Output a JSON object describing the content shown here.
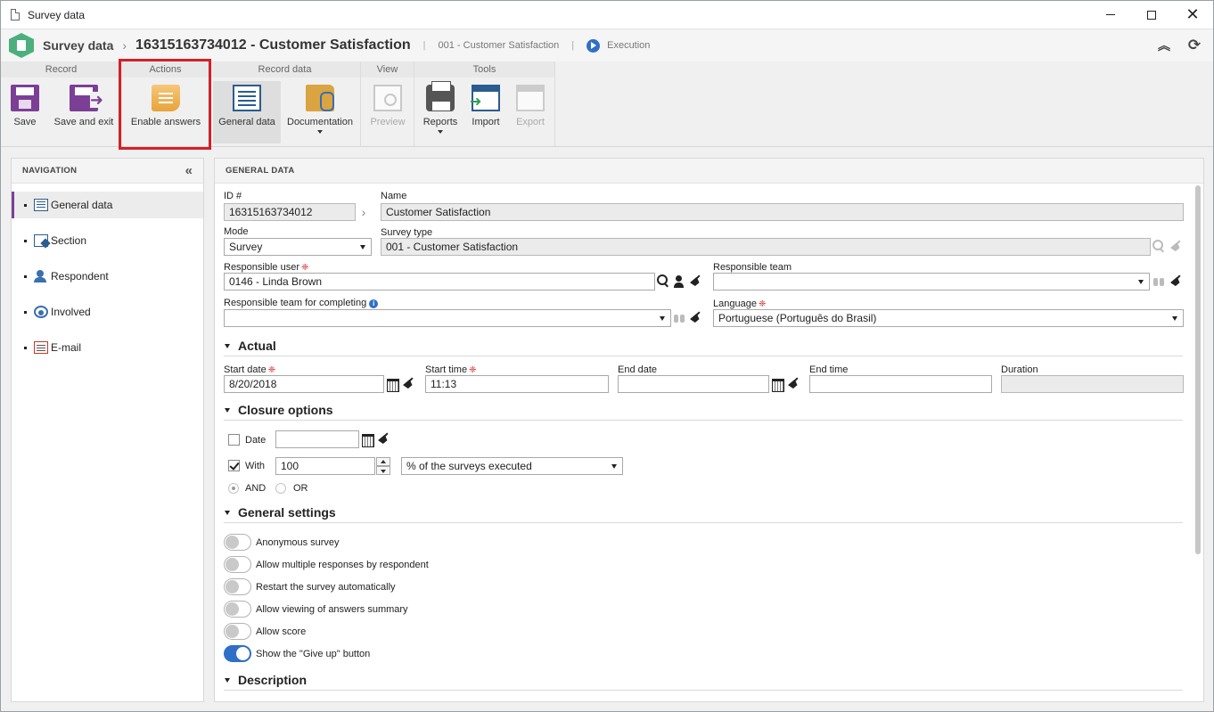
{
  "window": {
    "title": "Survey data"
  },
  "header": {
    "app_name": "Survey data",
    "record_title": "16315163734012 - Customer Satisfaction",
    "sub_record": "001 - Customer Satisfaction",
    "status": "Execution"
  },
  "ribbon": {
    "groups": {
      "record": "Record",
      "actions": "Actions",
      "record_data": "Record data",
      "view": "View",
      "tools": "Tools"
    },
    "buttons": {
      "save": "Save",
      "save_exit": "Save and exit",
      "enable_answers": "Enable answers",
      "general_data": "General data",
      "documentation": "Documentation",
      "preview": "Preview",
      "reports": "Reports",
      "import": "Import",
      "export": "Export"
    }
  },
  "navigation": {
    "title": "NAVIGATION",
    "items": [
      {
        "label": "General data",
        "icon": "list-icon"
      },
      {
        "label": "Section",
        "icon": "section-icon"
      },
      {
        "label": "Respondent",
        "icon": "respondent-icon"
      },
      {
        "label": "Involved",
        "icon": "involved-icon"
      },
      {
        "label": "E-mail",
        "icon": "email-icon"
      }
    ]
  },
  "form": {
    "title": "GENERAL DATA",
    "id_label": "ID #",
    "id_value": "16315163734012",
    "name_label": "Name",
    "name_value": "Customer Satisfaction",
    "mode_label": "Mode",
    "mode_value": "Survey",
    "survey_type_label": "Survey type",
    "survey_type_value": "001 - Customer Satisfaction",
    "resp_user_label": "Responsible user",
    "resp_user_value": "0146 - Linda Brown",
    "resp_team_label": "Responsible team",
    "resp_team_value": "",
    "resp_team_completing_label": "Responsible team for completing",
    "resp_team_completing_value": "",
    "language_label": "Language",
    "language_value": "Portuguese (Português do Brasil)",
    "required_mark": "❈",
    "info_mark": "i",
    "actual": {
      "title": "Actual",
      "start_date_label": "Start date",
      "start_date_value": "8/20/2018",
      "start_time_label": "Start time",
      "start_time_value": "11:13",
      "end_date_label": "End date",
      "end_date_value": "",
      "end_time_label": "End time",
      "end_time_value": "",
      "duration_label": "Duration",
      "duration_value": ""
    },
    "closure": {
      "title": "Closure options",
      "date_label": "Date",
      "date_checked": false,
      "date_value": "",
      "with_label": "With",
      "with_checked": true,
      "with_value": "100",
      "with_unit": "% of the surveys executed",
      "and_label": "AND",
      "or_label": "OR"
    },
    "general_settings": {
      "title": "General settings",
      "toggles": [
        {
          "label": "Anonymous survey",
          "on": false
        },
        {
          "label": "Allow multiple responses by respondent",
          "on": false
        },
        {
          "label": "Restart the survey automatically",
          "on": false
        },
        {
          "label": "Allow viewing of answers summary",
          "on": false
        },
        {
          "label": "Allow score",
          "on": false
        },
        {
          "label": "Show the \"Give up\" button",
          "on": true
        }
      ]
    },
    "description": {
      "title": "Description"
    }
  },
  "colors": {
    "accent": "#7b3f95",
    "toggle_on": "#2f6fc7",
    "highlight": "#d32027"
  }
}
